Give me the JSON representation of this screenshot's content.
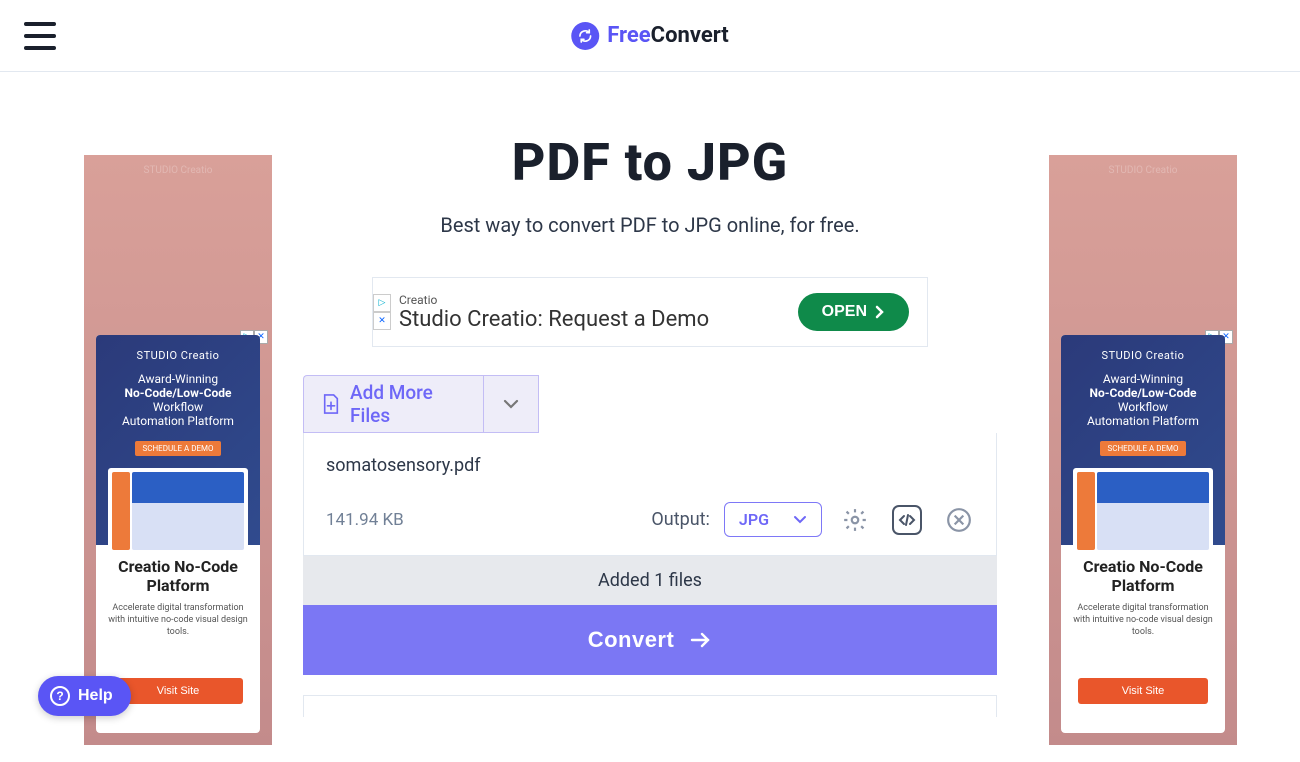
{
  "header": {
    "brand_free": "Free",
    "brand_convert": "Convert"
  },
  "page": {
    "title": "PDF to JPG",
    "subtitle": "Best way to convert PDF to JPG online, for free."
  },
  "top_ad": {
    "brand": "Creatio",
    "title": "Studio Creatio: Request a Demo",
    "cta": "OPEN"
  },
  "add_files": {
    "label": "Add More Files"
  },
  "file": {
    "name": "somatosensory.pdf",
    "size": "141.94 KB",
    "output_label": "Output:",
    "output_value": "JPG"
  },
  "status": "Added 1 files",
  "convert_label": "Convert",
  "side_ad": {
    "brand": "STUDIO Creatio",
    "line1": "Award-Winning",
    "line2_bold": "No-Code/Low-Code",
    "line2_rest": " Workflow",
    "line3": "Automation Platform",
    "pill": "SCHEDULE A DEMO",
    "heading": "Creatio No-Code Platform",
    "paragraph": "Accelerate digital transformation with intuitive no-code visual design tools.",
    "visit": "Visit Site",
    "faint_top": "STUDIO Creatio"
  },
  "help": {
    "label": "Help"
  }
}
